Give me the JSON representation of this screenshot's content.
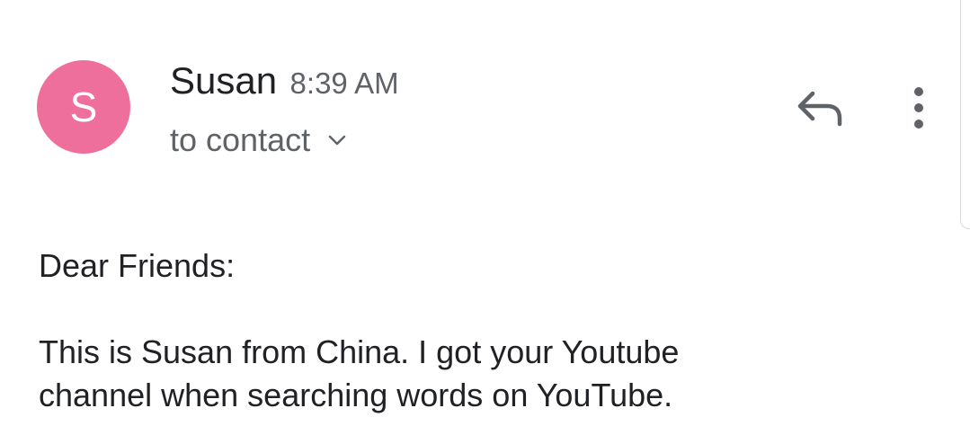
{
  "message": {
    "sender": {
      "initial": "S",
      "name": "Susan",
      "time": "8:39 AM",
      "avatar_color": "#ef6f9c"
    },
    "recipient_label": "to contact",
    "icons": {
      "expand": "chevron-down-icon",
      "reply": "reply-icon",
      "more": "more-vert-icon"
    },
    "body": {
      "greeting": "Dear Friends:",
      "lines": [
        "This is Susan from China. I got your Youtube",
        "channel when searching words on YouTube."
      ]
    }
  }
}
